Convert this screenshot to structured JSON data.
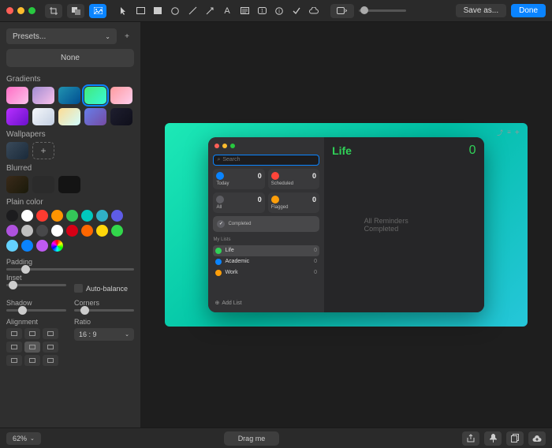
{
  "topbar": {
    "save_as": "Save as...",
    "done": "Done"
  },
  "sidebar": {
    "presets_label": "Presets...",
    "none_label": "None",
    "gradients_label": "Gradients",
    "gradient_swatches": [
      "linear-gradient(135deg,#ff6ec4,#fbc2eb)",
      "linear-gradient(135deg,#a18cd1,#fbc2eb)",
      "linear-gradient(135deg,#2193b0,#004e92)",
      "linear-gradient(135deg,#43e97b,#38f9d7)",
      "linear-gradient(135deg,#ff9a9e,#fecfef)",
      "linear-gradient(135deg,#b82fff,#6a11cb)",
      "linear-gradient(135deg,#f5f7fa,#c3cfe2)",
      "linear-gradient(135deg,#fddb92,#d1fdff)",
      "linear-gradient(135deg,#667eea,#764ba2)",
      "linear-gradient(135deg,#1e1e2f,#0f0f1a)"
    ],
    "gradient_selected_index": 3,
    "wallpapers_label": "Wallpapers",
    "blurred_label": "Blurred",
    "blurred_swatches": [
      "linear-gradient(135deg,#3a2a1a,#1a1a0a)",
      "#2b2b2b",
      "#141414"
    ],
    "plain_label": "Plain color",
    "plain_colors": [
      "#1c1c1e",
      "#ffffff",
      "#ff3b30",
      "#ff9500",
      "#34c759",
      "#00c7be",
      "#30b0c7",
      "#5e5ce6",
      "#af52de",
      "#c0c0c0",
      "#48484a",
      "#ffffff",
      "#d70015",
      "#ff6700",
      "#ffd60a",
      "#32d74b",
      "#64d2ff",
      "#0a84ff",
      "#bf5af2",
      "conic-gradient(red,yellow,lime,cyan,blue,magenta,red)"
    ],
    "padding_label": "Padding",
    "padding_value_pct": 12,
    "inset_label": "Inset",
    "inset_value_pct": 4,
    "autobalance_label": "Auto-balance",
    "shadow_label": "Shadow",
    "shadow_value_pct": 20,
    "corners_label": "Corners",
    "corners_value_pct": 10,
    "alignment_label": "Alignment",
    "ratio_label": "Ratio",
    "ratio_value": "16 : 9"
  },
  "app": {
    "search_placeholder": "Search",
    "boxes": [
      {
        "id": "today",
        "label": "Today",
        "count": 0,
        "color": "#0a84ff"
      },
      {
        "id": "scheduled",
        "label": "Scheduled",
        "count": 0,
        "color": "#ff453a"
      },
      {
        "id": "all",
        "label": "All",
        "count": 0,
        "color": "#5e5e63"
      },
      {
        "id": "flagged",
        "label": "Flagged",
        "count": 0,
        "color": "#ff9f0a"
      }
    ],
    "completed_label": "Completed",
    "mylists_label": "My Lists",
    "lists": [
      {
        "name": "Life",
        "count": 0,
        "color": "#30d158",
        "selected": true
      },
      {
        "name": "Academic",
        "count": 0,
        "color": "#0a84ff",
        "selected": false
      },
      {
        "name": "Work",
        "count": 0,
        "color": "#ff9f0a",
        "selected": false
      }
    ],
    "addlist_label": "Add List",
    "main_title": "Life",
    "main_count": "0",
    "empty_text": "All Reminders Completed"
  },
  "bottombar": {
    "zoom": "62%",
    "drag": "Drag me"
  }
}
